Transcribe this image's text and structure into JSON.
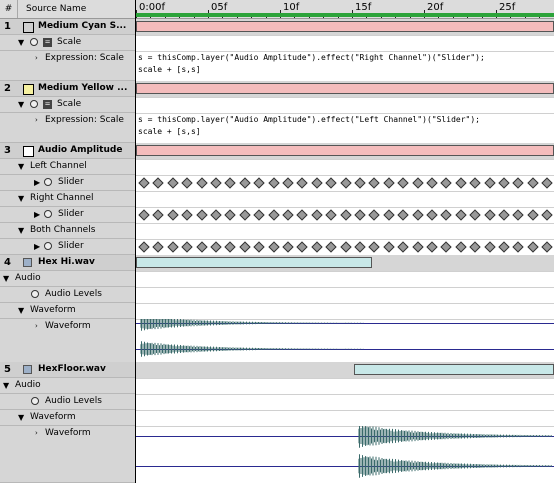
{
  "header": {
    "hash": "#",
    "source_name": "Source Name"
  },
  "ruler": {
    "labels": [
      "0:00f",
      "05f",
      "10f",
      "15f",
      "20f",
      "25f"
    ]
  },
  "layers": [
    {
      "num": "1",
      "name": "Medium Cyan S...",
      "swatch": "#8fd8e6"
    },
    {
      "num": "2",
      "name": "Medium Yellow ...",
      "swatch": "#f5f0a0"
    },
    {
      "num": "3",
      "name": "Audio Amplitude",
      "swatch": "#ffffff"
    },
    {
      "num": "4",
      "name": "Hex Hi.wav"
    },
    {
      "num": "5",
      "name": "HexFloor.wav"
    }
  ],
  "props": {
    "scale": "Scale",
    "expression_scale": "Expression: Scale",
    "left_channel": "Left Channel",
    "right_channel": "Right Channel",
    "both_channels": "Both Channels",
    "slider": "Slider",
    "audio": "Audio",
    "audio_levels": "Audio Levels",
    "waveform": "Waveform"
  },
  "expressions": {
    "layer1_line1": "s = thisComp.layer(\"Audio Amplitude\").effect(\"Right Channel\")(\"Slider\");",
    "layer1_line2": "scale + [s,s]",
    "layer2_line1": "s = thisComp.layer(\"Audio Amplitude\").effect(\"Left Channel\")(\"Slider\");",
    "layer2_line2": "scale + [s,s]"
  },
  "colors": {
    "work_area": "#2ca33a",
    "layer_bar_red": "#f4bcbc",
    "layer_bar_cyan": "#c8e8e8",
    "waveform_line": "#2a2a90"
  }
}
